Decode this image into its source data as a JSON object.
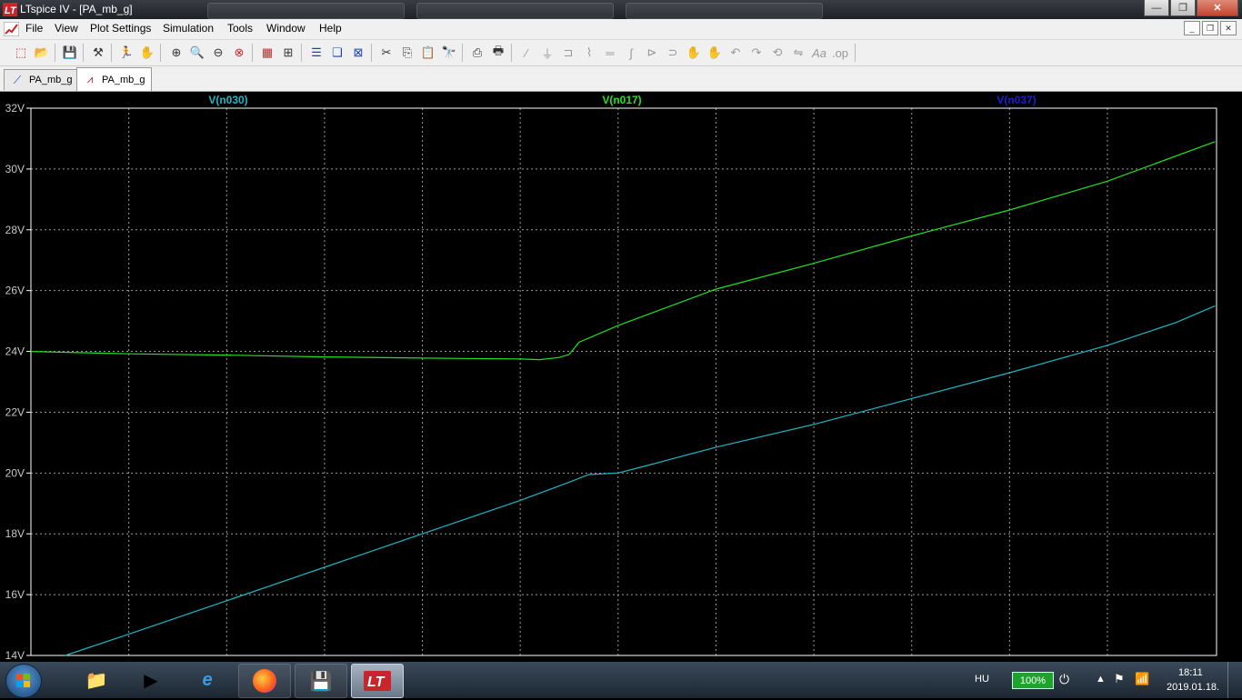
{
  "window": {
    "title": "LTspice IV - [PA_mb_g]",
    "minimize_glyph": "—",
    "maximize_glyph": "❐",
    "close_glyph": "✕"
  },
  "menu": {
    "items": [
      "File",
      "View",
      "Plot Settings",
      "Simulation",
      "Tools",
      "Window",
      "Help"
    ]
  },
  "tabs": [
    {
      "label": "PA_mb_g",
      "icon": "schematic-icon",
      "active": false
    },
    {
      "label": "PA_mb_g",
      "icon": "waveform-icon",
      "active": true
    }
  ],
  "colors": {
    "trace_n030": "#1fb6c4",
    "trace_n017": "#22e022",
    "trace_n037": "#1d1dd8",
    "axis": "#ffffff",
    "grid": "#9a9a9a",
    "background": "#000000"
  },
  "chart_data": {
    "type": "line",
    "ylim": [
      14,
      32
    ],
    "y_unit": "V",
    "yticks": [
      "32V",
      "30V",
      "28V",
      "26V",
      "24V",
      "22V",
      "20V",
      "18V",
      "16V",
      "14V"
    ],
    "x_divisions": 11,
    "grid": true,
    "series": [
      {
        "name": "V(n030)",
        "color": "#1fb6c4",
        "points": [
          [
            0.35,
            14.0
          ],
          [
            1.0,
            14.7
          ],
          [
            2.0,
            15.8
          ],
          [
            3.0,
            16.9
          ],
          [
            4.0,
            18.0
          ],
          [
            5.0,
            19.1
          ],
          [
            5.5,
            19.7
          ],
          [
            5.7,
            19.95
          ],
          [
            6.0,
            20.0
          ],
          [
            6.3,
            20.25
          ],
          [
            7.0,
            20.85
          ],
          [
            8.0,
            21.6
          ],
          [
            9.0,
            22.45
          ],
          [
            10.0,
            23.3
          ],
          [
            11.0,
            24.2
          ],
          [
            11.7,
            24.95
          ],
          [
            12.1,
            25.5
          ]
        ]
      },
      {
        "name": "V(n017)",
        "color": "#22e022",
        "points": [
          [
            0,
            24.0
          ],
          [
            1.0,
            23.92
          ],
          [
            2.0,
            23.88
          ],
          [
            3.0,
            23.82
          ],
          [
            4.0,
            23.78
          ],
          [
            5.0,
            23.75
          ],
          [
            5.2,
            23.73
          ],
          [
            5.4,
            23.8
          ],
          [
            5.5,
            23.9
          ],
          [
            5.6,
            24.3
          ],
          [
            6.0,
            24.85
          ],
          [
            7.0,
            26.05
          ],
          [
            8.0,
            26.9
          ],
          [
            9.0,
            27.8
          ],
          [
            10.0,
            28.65
          ],
          [
            11.0,
            29.6
          ],
          [
            12.1,
            30.9
          ]
        ]
      },
      {
        "name": "V(n037)",
        "color": "#1d1dd8",
        "points": []
      }
    ]
  },
  "taskbar": {
    "language": "HU",
    "battery": "100%",
    "time": "18:11",
    "date": "2019.01.18."
  }
}
